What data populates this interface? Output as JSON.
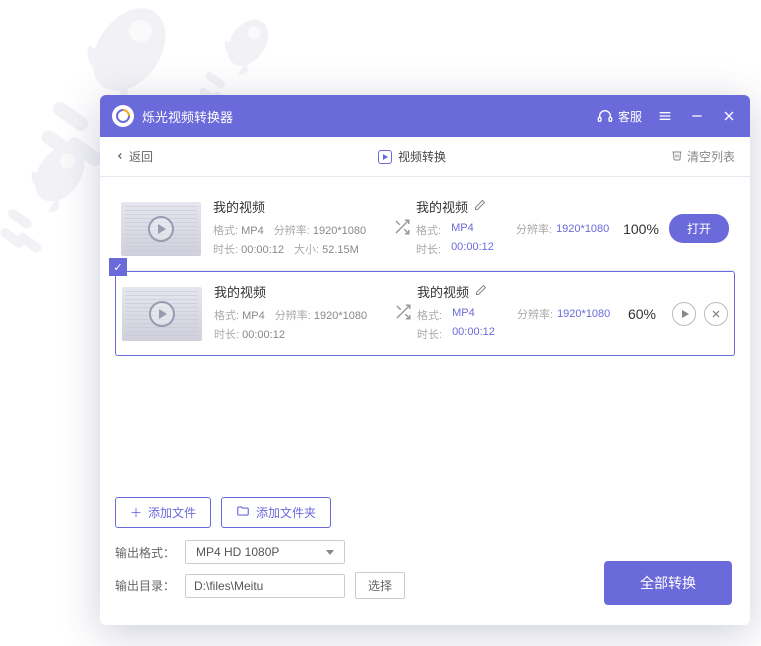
{
  "titlebar": {
    "app_title": "烁光视频转换器",
    "support_label": "客服"
  },
  "toolbar": {
    "back_label": "返回",
    "tab_label": "视频转换",
    "clear_list_label": "清空列表"
  },
  "items": [
    {
      "name_left": "我的视频",
      "format_label": "格式:",
      "format_val": "MP4",
      "resolution_label": "分辨率:",
      "resolution_val": "1920*1080",
      "duration_label": "时长:",
      "duration_val": "00:00:12",
      "size_label": "大小:",
      "size_val": "52.15M",
      "name_right": "我的视频",
      "out_format_label": "格式:",
      "out_format_val": "MP4",
      "out_duration_label": "时长:",
      "out_duration_val": "00:00:12",
      "out_res_label": "分辨率:",
      "out_res_val": "1920*1080",
      "percent": "100%",
      "open_label": "打开",
      "status": "done"
    },
    {
      "name_left": "我的视频",
      "format_label": "格式:",
      "format_val": "MP4",
      "resolution_label": "分辨率:",
      "resolution_val": "1920*1080",
      "duration_label": "时长:",
      "duration_val": "00:00:12",
      "name_right": "我的视频",
      "out_format_label": "格式:",
      "out_format_val": "MP4",
      "out_duration_label": "时长:",
      "out_duration_val": "00:00:12",
      "out_res_label": "分辨率:",
      "out_res_val": "1920*1080",
      "percent": "60%",
      "status": "running"
    }
  ],
  "bottom": {
    "add_file_label": "添加文件",
    "add_folder_label": "添加文件夹",
    "format_label": "输出格式：",
    "format_value": "MP4 HD 1080P",
    "dir_label": "输出目录：",
    "dir_value": "D:\\files\\Meitu",
    "browse_label": "选择",
    "convert_all_label": "全部转换"
  }
}
